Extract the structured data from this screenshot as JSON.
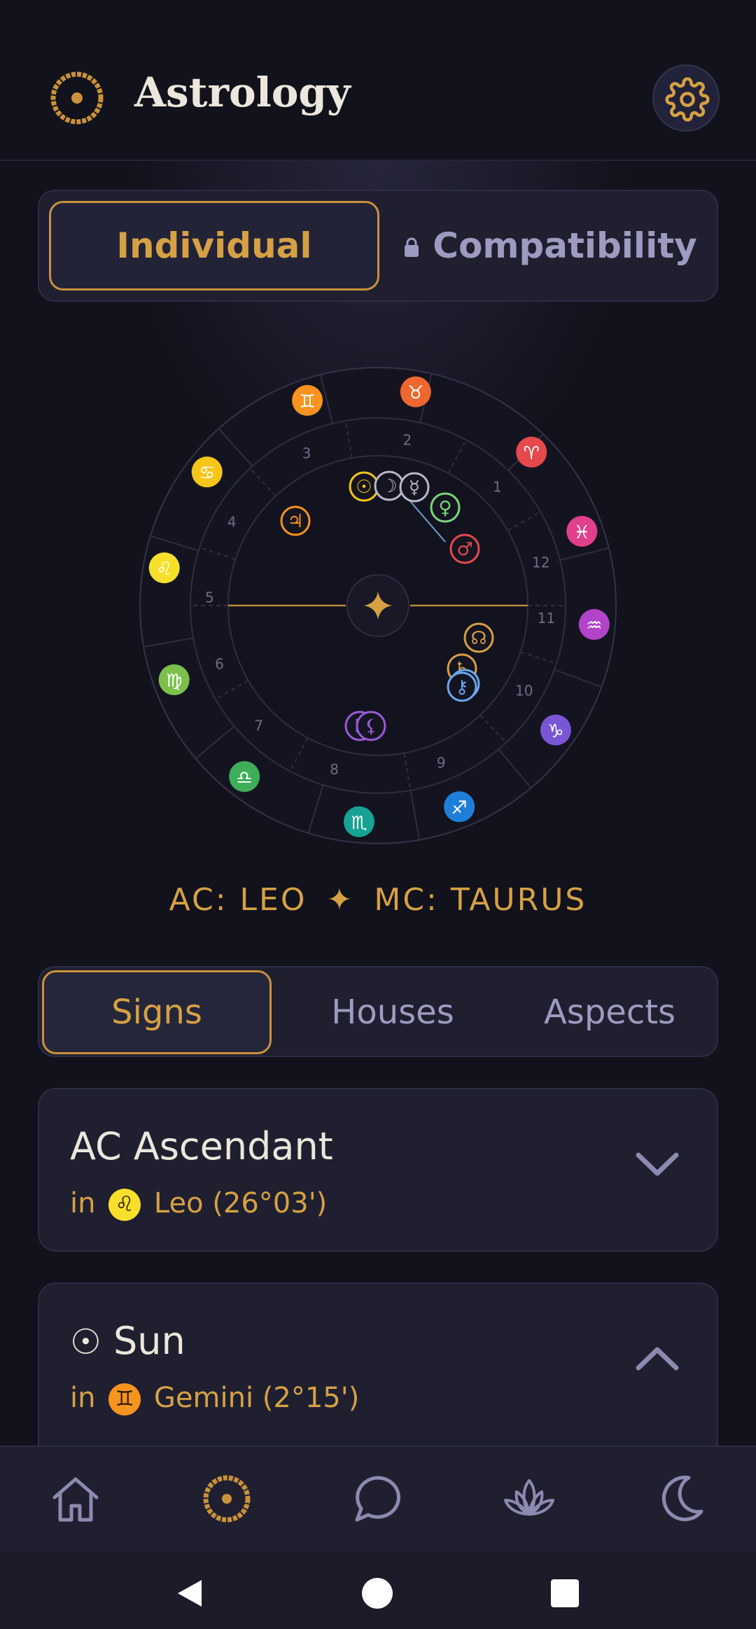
{
  "app": {
    "title": "Astrology"
  },
  "header": {
    "logo_icon": "sun-logo-icon",
    "settings_icon": "gear-icon"
  },
  "mode_tabs": [
    {
      "label": "Individual",
      "active": true
    },
    {
      "label": "Compatibility",
      "active": false,
      "locked": true
    }
  ],
  "chart": {
    "houses": [
      "1",
      "2",
      "3",
      "4",
      "5",
      "6",
      "7",
      "8",
      "9",
      "10",
      "11",
      "12"
    ],
    "signs": [
      {
        "name": "Aries",
        "glyph": "♈",
        "color": "#e5484d"
      },
      {
        "name": "Taurus",
        "glyph": "♉",
        "color": "#f0672e"
      },
      {
        "name": "Gemini",
        "glyph": "♊",
        "color": "#f7931e"
      },
      {
        "name": "Cancer",
        "glyph": "♋",
        "color": "#f5c518"
      },
      {
        "name": "Leo",
        "glyph": "♌",
        "color": "#f7e02a"
      },
      {
        "name": "Virgo",
        "glyph": "♍",
        "color": "#7cc04b"
      },
      {
        "name": "Libra",
        "glyph": "♎",
        "color": "#3fae5a"
      },
      {
        "name": "Scorpio",
        "glyph": "♏",
        "color": "#17a294"
      },
      {
        "name": "Sagittarius",
        "glyph": "♐",
        "color": "#1f7fd8"
      },
      {
        "name": "Capricorn",
        "glyph": "♑",
        "color": "#7a56d6"
      },
      {
        "name": "Aquarius",
        "glyph": "♒",
        "color": "#b144c9"
      },
      {
        "name": "Pisces",
        "glyph": "♓",
        "color": "#e0408a"
      }
    ],
    "planets": [
      {
        "name": "Sun",
        "glyph": "☉",
        "color": "#f5c518"
      },
      {
        "name": "Moon",
        "glyph": "☽",
        "color": "#b8b8c8"
      },
      {
        "name": "Mercury",
        "glyph": "☿",
        "color": "#b8b8c8"
      },
      {
        "name": "Venus",
        "glyph": "♀",
        "color": "#7cd67c"
      },
      {
        "name": "Mars",
        "glyph": "♂",
        "color": "#e5484d"
      },
      {
        "name": "Jupiter",
        "glyph": "♃",
        "color": "#f7931e"
      },
      {
        "name": "North Node",
        "glyph": "☊",
        "color": "#d6a144"
      },
      {
        "name": "Saturn",
        "glyph": "♄",
        "color": "#d6a144"
      },
      {
        "name": "Neptune",
        "glyph": "♆",
        "color": "#6aa8f0"
      },
      {
        "name": "Chiron",
        "glyph": "⚷",
        "color": "#6aa8f0"
      },
      {
        "name": "Pluto",
        "glyph": "♇",
        "color": "#9a5ad6"
      },
      {
        "name": "Lilith",
        "glyph": "⚸",
        "color": "#9a5ad6"
      }
    ],
    "center_icon": "star-icon"
  },
  "angles": {
    "ac": "AC: LEO",
    "separator": "✦",
    "mc": "MC: TAURUS"
  },
  "sub_tabs": [
    {
      "label": "Signs",
      "active": true
    },
    {
      "label": "Houses",
      "active": false
    },
    {
      "label": "Aspects",
      "active": false
    }
  ],
  "cards": [
    {
      "title": "AC Ascendant",
      "prefix": "in",
      "sign_glyph": "♌",
      "sign_color": "#f7e02a",
      "detail": "Leo (26°03')",
      "expanded": false
    },
    {
      "title_icon": "☉",
      "title": "Sun",
      "prefix": "in",
      "sign_glyph": "♊",
      "sign_color": "#f7931e",
      "detail": "Gemini (2°15')",
      "expanded": true
    }
  ],
  "nav": [
    "home-icon",
    "chart-icon",
    "chat-icon",
    "lotus-icon",
    "moon-icon"
  ],
  "accent": "#d6a144"
}
